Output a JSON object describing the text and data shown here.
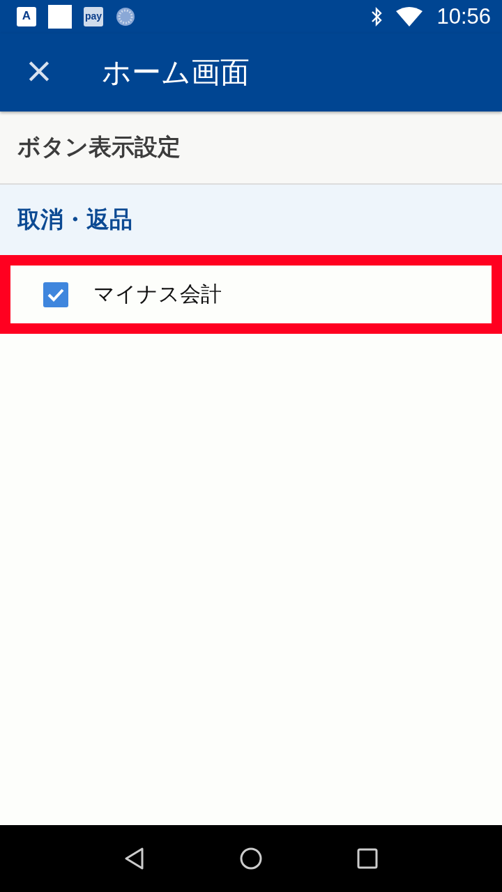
{
  "status_bar": {
    "app_icons": [
      {
        "kind": "letter",
        "text": "A"
      },
      {
        "kind": "blank"
      },
      {
        "kind": "letter",
        "text": "pay"
      },
      {
        "kind": "spinner"
      }
    ],
    "time": "10:56"
  },
  "app_bar": {
    "close": "×",
    "title": "ホーム画面"
  },
  "section_header": "ボタン表示設定",
  "category_header": "取消・返品",
  "items": [
    {
      "label": "マイナス会計",
      "checked": true,
      "highlighted": true
    }
  ]
}
